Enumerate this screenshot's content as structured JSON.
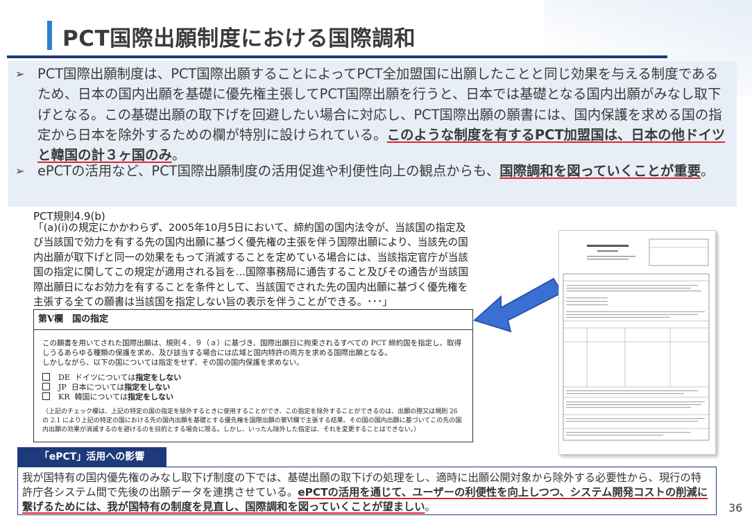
{
  "slide": {
    "title": "PCT国際出願制度における国際調和",
    "page_number": "36"
  },
  "bullets": [
    {
      "marker": "➢",
      "text": "PCT国際出願制度は、PCT国際出願することによってPCT全加盟国に出願したことと同じ効果を与える制度であるため、日本の国内出願を基礎に優先権主張してPCT国際出願を行うと、日本では基礎となる国内出願がみなし取下げとなる。この基礎出願の取下げを回避したい場合に対応し、PCT国際出願の願書には、国内保護を求める国の指定から日本を除外するための欄が特別に設けられている。",
      "emphasis": "このような制度を有するPCT加盟国は、日本の他ドイツと韓国の計３ヶ国のみ",
      "tail": "。"
    },
    {
      "marker": "➢",
      "text": "ePCTの活用など、PCT国際出願制度の活用促進や利便性向上の観点からも、",
      "emphasis": "国際調和を図っていくことが重要",
      "tail": "。"
    }
  ],
  "rule_quote": {
    "heading": "PCT規則4.9(b)",
    "body": "「(a)(i)の規定にかかわらず、2005年10月5日において、締約国の国内法令が、当該国の指定及び当該国で効力を有する先の国内出願に基づく優先権の主張を伴う国際出願により、当該先の国内出願が取下げと同一の効果をもって消滅することを定めている場合には、当該指定官庁が当該国の指定に関してこの規定が適用される旨を…国際事務局に通告すること及びその通告が当該国際出願日になお効力を有することを条件として、当該国でされた先の国内出願に基づく優先権を主張する全ての願書は当該国を指定しない旨の表示を伴うことができる。･･･」"
  },
  "form_excerpt": {
    "header": "第Ⅴ欄　国の指定",
    "paragraph": "この願書を用いてされた国際出願は、規則４．９（ａ）に基づき、国際出願日に拘束されるすべての PCT 締約国を指定し、取得しうるあらゆる種類の保護を求め、及び該当する場合には広域と国内特許の両方を求める国際出願となる。",
    "exception": "しかしながら、以下の国については指定をせず、その国の国内保護を求めない。",
    "checks": [
      {
        "code": "DE",
        "text": "ドイツについては",
        "bold": "指定をしない"
      },
      {
        "code": "JP",
        "text": "日本については",
        "bold": "指定をしない"
      },
      {
        "code": "KR",
        "text": "韓国については",
        "bold": "指定をしない"
      }
    ],
    "note": "（上記のチェック欄は、上記の特定の国の指定を除外するときに使用することができ、この指定を除外することができるのは、出願の際又は規則 26 の 2.1 により上記の特定の国における先の国内出願を基礎とする優先権を国際出願の第Ⅵ欄で主張する結果、その国の国内出願に基づいてこの先の国内出願の効果が消滅するのを避けるのを目的とする場合に限る。しかし、いったん除外した指定は、それを変更することはできない。）"
  },
  "epct": {
    "label": "「ePCT」活用への影響",
    "text": "我が国特有の国内優先権のみなし取下げ制度の下では、基礎出願の取下げの処理をし、適時に出願公開対象から除外する必要性から、現行の特許庁各システム間で先後の出願データを連携させている。",
    "emphasis": "ePCTの活用を通じて、ユーザーの利便性を向上しつつ、システム開発コストの削減に繋げるためには、我が国特有の制度を見直し、国際調和を図っていくことが望ましい",
    "tail": "。"
  },
  "colors": {
    "accent_blue": "#2f7fd3",
    "navy": "#1f3a7a",
    "underline_red": "#e0242c",
    "bullet_bg": "#e8eef6"
  }
}
